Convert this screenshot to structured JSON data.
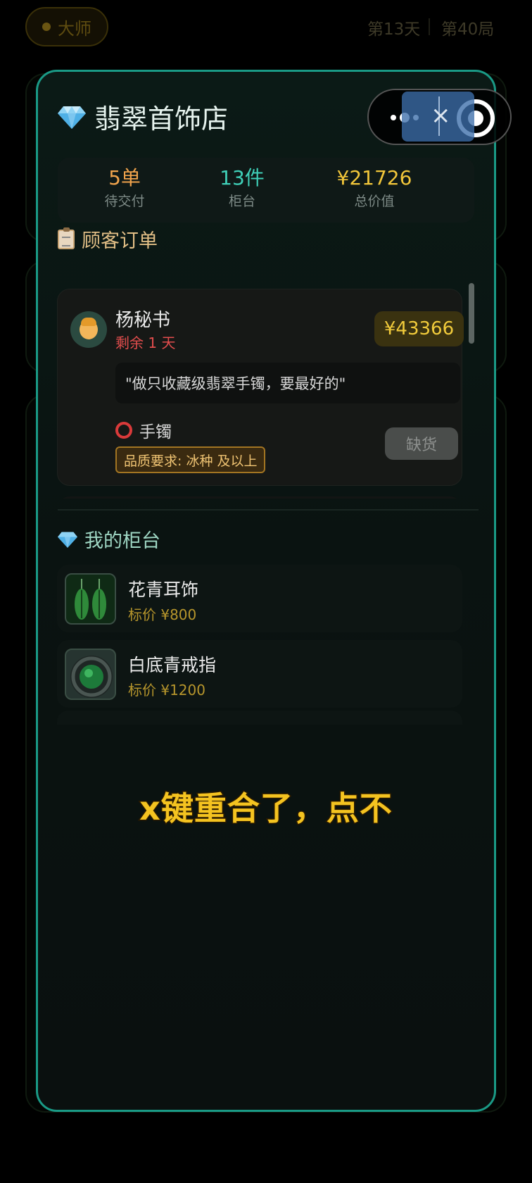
{
  "background": {
    "rank_label": "大师",
    "day_label": "第13天",
    "round_label": "第40局"
  },
  "shop": {
    "title": "翡翠首饰店",
    "stats": [
      {
        "value": "5单",
        "label": "待交付",
        "color": "#f0a34c"
      },
      {
        "value": "13件",
        "label": "柜台",
        "color": "#3fd0b8"
      },
      {
        "value": "¥21726",
        "label": "总价值",
        "color": "#f1c63a"
      }
    ]
  },
  "orders": {
    "section_title": "顾客订单",
    "items": [
      {
        "customer": "杨秘书",
        "deadline": "剩余 1 天",
        "price": "¥43366",
        "quote": "\"做只收藏级翡翠手镯，要最好的\"",
        "item_type": "手镯",
        "quality_requirement": "品质要求: 冰种 及以上",
        "action_label": "缺货"
      }
    ]
  },
  "counter": {
    "section_title": "我的柜台",
    "items": [
      {
        "name": "花青耳饰",
        "price": "标价 ¥800",
        "icon": "earring-icon"
      },
      {
        "name": "白底青戒指",
        "price": "标价 ¥1200",
        "icon": "ring-icon"
      }
    ]
  },
  "caption": "x键重合了，点不"
}
